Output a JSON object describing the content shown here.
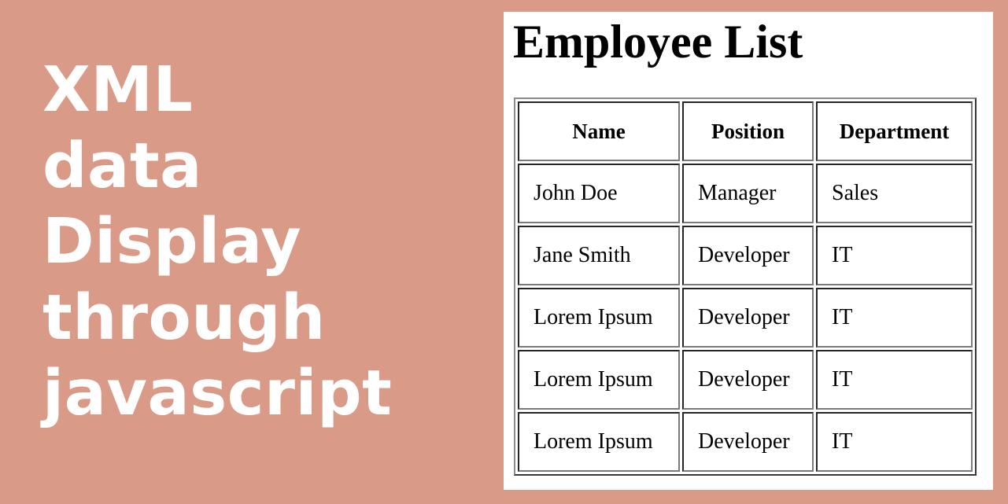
{
  "banner": {
    "title_lines": [
      "XML",
      "data",
      "Display",
      "through",
      "javascript"
    ],
    "background_color": "#d99a87",
    "text_color": "#ffffff"
  },
  "panel": {
    "heading": "Employee List",
    "table": {
      "columns": [
        "Name",
        "Position",
        "Department"
      ],
      "rows": [
        [
          "John Doe",
          "Manager",
          "Sales"
        ],
        [
          "Jane Smith",
          "Developer",
          "IT"
        ],
        [
          "Lorem Ipsum",
          "Developer",
          "IT"
        ],
        [
          "Lorem Ipsum",
          "Developer",
          "IT"
        ],
        [
          "Lorem Ipsum",
          "Developer",
          "IT"
        ]
      ]
    }
  }
}
